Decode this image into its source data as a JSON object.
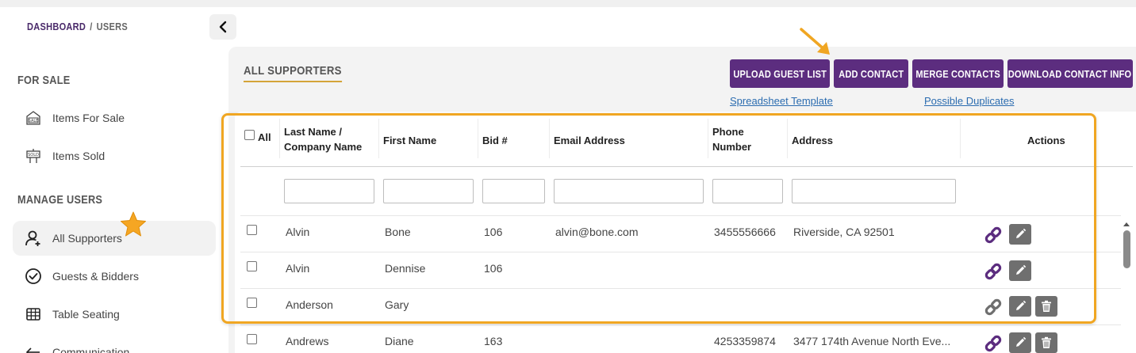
{
  "breadcrumb": {
    "dashboard": "DASHBOARD",
    "separator": "/",
    "current": "USERS"
  },
  "sidebar": {
    "for_sale_title": "FOR SALE",
    "items_for_sale": "Items For Sale",
    "items_sold": "Items Sold",
    "manage_users_title": "MANAGE USERS",
    "all_supporters": "All Supporters",
    "guests_bidders": "Guests & Bidders",
    "table_seating": "Table Seating",
    "communication": "Communication"
  },
  "main": {
    "title": "ALL SUPPORTERS",
    "buttons": {
      "upload": "UPLOAD GUEST LIST",
      "add": "ADD CONTACT",
      "merge": "MERGE CONTACTS",
      "download": "DOWNLOAD CONTACT INFO"
    },
    "links": {
      "template": "Spreadsheet Template",
      "duplicates": "Possible Duplicates"
    }
  },
  "table": {
    "headers": {
      "all": "All",
      "last_name_1": "Last Name /",
      "last_name_2": "Company Name",
      "first_name": "First Name",
      "bid": "Bid #",
      "email": "Email Address",
      "phone_1": "Phone",
      "phone_2": "Number",
      "address": "Address",
      "actions": "Actions"
    },
    "rows": [
      {
        "last": "Alvin",
        "first": "Bone",
        "bid": "106",
        "email": "alvin@bone.com",
        "phone": "3455556666",
        "address": "Riverside, CA 92501"
      },
      {
        "last": "Alvin",
        "first": "Dennise",
        "bid": "106",
        "email": "",
        "phone": "",
        "address": ""
      },
      {
        "last": "Anderson",
        "first": "Gary",
        "bid": "",
        "email": "",
        "phone": "",
        "address": ""
      },
      {
        "last": "Andrews",
        "first": "Diane",
        "bid": "163",
        "email": "",
        "phone": "4253359874",
        "address": "3477 174th Avenue North Eve..."
      }
    ]
  },
  "colors": {
    "primary": "#5c2d7f",
    "accent": "#f0a622",
    "link_active": "#5c2d7f",
    "link_inactive": "#6f6f6f"
  },
  "icons": [
    "chevron-left-icon",
    "sale-tag-icon",
    "sold-sign-icon",
    "user-plus-icon",
    "check-circle-icon",
    "table-grid-icon",
    "back-arrow-icon",
    "link-icon",
    "pencil-icon",
    "trash-icon",
    "star-icon",
    "arrow-icon"
  ]
}
